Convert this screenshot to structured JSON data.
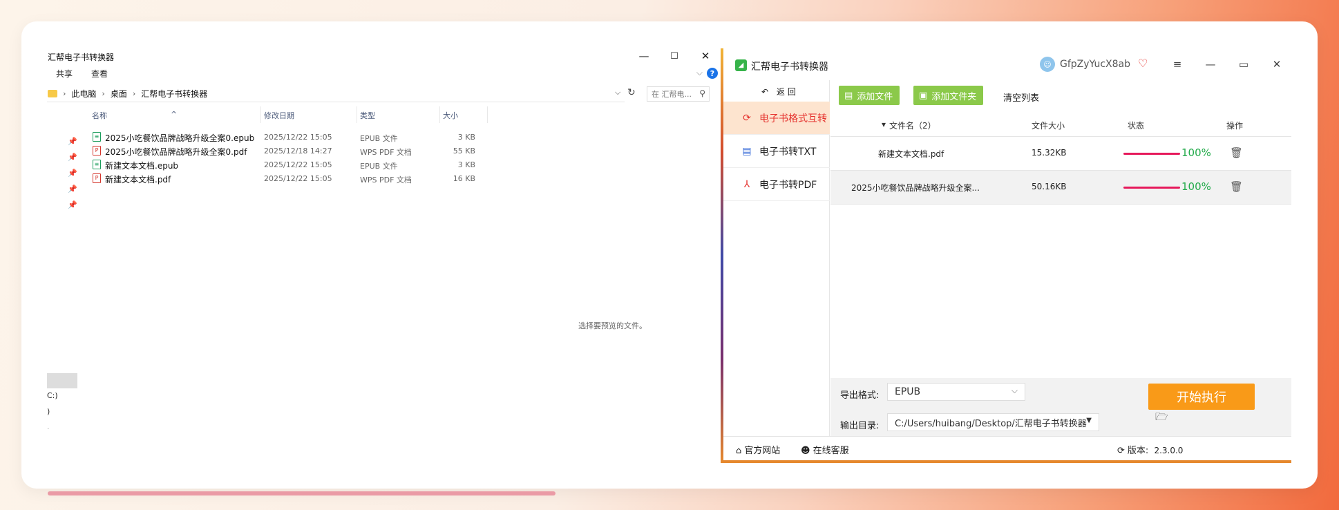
{
  "explorer": {
    "title": "汇帮电子书转换器",
    "window_controls": {
      "minimize": "—",
      "maximize": "☐",
      "close": "✕"
    },
    "ribbon": {
      "share": "共享",
      "view": "查看",
      "help": "?"
    },
    "breadcrumb": [
      "此电脑",
      "桌面",
      "汇帮电子书转换器"
    ],
    "search_placeholder": "在 汇帮电...",
    "columns": {
      "name": "名称",
      "date": "修改日期",
      "type": "类型",
      "size": "大小"
    },
    "files": [
      {
        "name": "2025小吃餐饮品牌战略升级全案0.epub",
        "date": "2025/12/22 15:05",
        "type": "EPUB 文件",
        "size": "3 KB",
        "kind": "epub"
      },
      {
        "name": "2025小吃餐饮品牌战略升级全案0.pdf",
        "date": "2025/12/18 14:27",
        "type": "WPS PDF 文档",
        "size": "55 KB",
        "kind": "pdf"
      },
      {
        "name": "新建文本文档.epub",
        "date": "2025/12/22 15:05",
        "type": "EPUB 文件",
        "size": "3 KB",
        "kind": "epub"
      },
      {
        "name": "新建文本文档.pdf",
        "date": "2025/12/22 15:05",
        "type": "WPS PDF 文档",
        "size": "16 KB",
        "kind": "pdf"
      }
    ],
    "preview_hint": "选择要预览的文件。",
    "nav_fragments": [
      "C:)",
      ")",
      "."
    ]
  },
  "converter": {
    "app_title": "汇帮电子书转换器",
    "username": "GfpZyYucX8ab",
    "title_controls": {
      "menu": "≡",
      "minimize": "—",
      "maximize": "▭",
      "close": "✕"
    },
    "back_label": "返回",
    "sidebar": [
      {
        "label": "电子书格式互转",
        "icon": "sync-icon",
        "active": true
      },
      {
        "label": "电子书转TXT",
        "icon": "doc-icon",
        "active": false
      },
      {
        "label": "电子书转PDF",
        "icon": "pdf-icon",
        "active": false
      }
    ],
    "toolbar": {
      "add_file": "添加文件",
      "add_folder": "添加文件夹",
      "clear_list": "清空列表"
    },
    "table": {
      "col_name": "文件名（2）",
      "col_size": "文件大小",
      "col_status": "状态",
      "col_action": "操作",
      "rows": [
        {
          "name": "新建文本文档.pdf",
          "size": "15.32KB",
          "progress": "100%"
        },
        {
          "name": "2025小吃餐饮品牌战略升级全案...",
          "size": "50.16KB",
          "progress": "100%"
        }
      ]
    },
    "export_format_label": "导出格式:",
    "export_format_value": "EPUB",
    "output_dir_label": "输出目录:",
    "output_dir_value": "C:/Users/huibang/Desktop/汇帮电子书转换器",
    "start_button": "开始执行",
    "footer": {
      "website": "官方网站",
      "support": "在线客服",
      "version_label": "版本:",
      "version_value": "2.3.0.0"
    },
    "colors": {
      "accent_green": "#8bc94a",
      "start_orange": "#f99a18",
      "active_red": "#e5302c",
      "progress_pink": "#e6195b",
      "percent_green": "#22aa4a"
    }
  }
}
